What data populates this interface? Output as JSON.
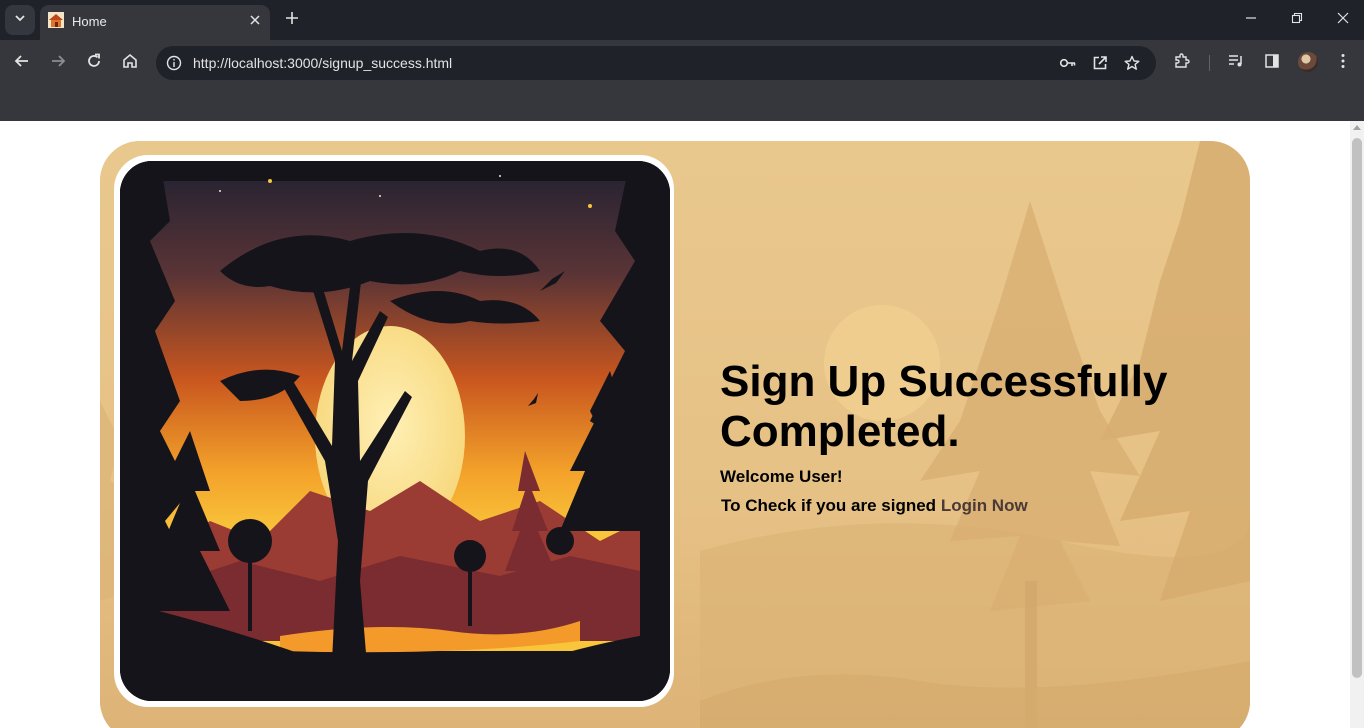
{
  "browser": {
    "tab": {
      "title": "Home",
      "favicon": "home-icon"
    },
    "address": {
      "url": "http://localhost:3000/signup_success.html"
    },
    "icons": {
      "tab_search": "chevron-down-icon",
      "tab_close": "close-icon",
      "new_tab": "plus-icon",
      "back": "back-arrow-icon",
      "forward": "forward-arrow-icon",
      "reload": "reload-icon",
      "home": "home-icon",
      "site_info": "info-icon",
      "passwords": "key-icon",
      "open_in_app": "open-external-icon",
      "bookmark": "star-icon",
      "extensions": "puzzle-icon",
      "media": "playlist-icon",
      "side_panel": "side-panel-icon",
      "profile": "avatar",
      "menu": "kebab-menu-icon",
      "minimize": "minimize-icon",
      "restore": "restore-icon",
      "close_window": "close-icon"
    }
  },
  "page": {
    "heading": "Sign Up Successfully Completed.",
    "welcome": "Welcome User!",
    "check_text": "To Check if you are signed",
    "login_link": "Login Now"
  },
  "colors": {
    "card_background": "#e6c185",
    "heading": "#000000",
    "link": "#4a3a35",
    "chrome_dark": "#1f2229",
    "chrome_toolbar": "#35373d"
  }
}
